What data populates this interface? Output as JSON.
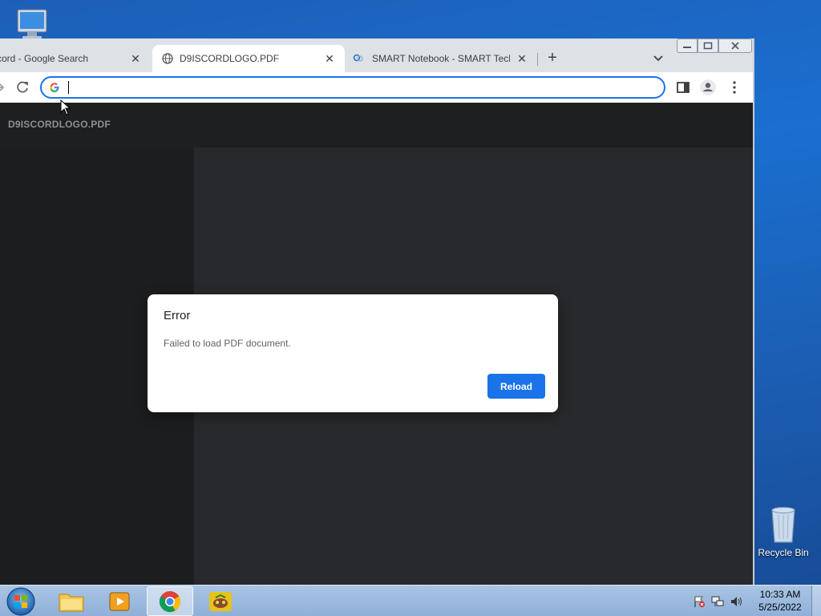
{
  "desktop": {
    "recycle_bin_label": "Recycle Bin"
  },
  "browser": {
    "tabs": [
      {
        "title": "cord - Google Search",
        "close": "✕"
      },
      {
        "title": "D9ISCORDLOGO.PDF",
        "close": "✕"
      },
      {
        "title": "SMART Notebook - SMART Techn",
        "close": "✕"
      }
    ],
    "new_tab": "+",
    "address_value": "",
    "pdf_title": "D9ISCORDLOGO.PDF"
  },
  "dialog": {
    "title": "Error",
    "message": "Failed to load PDF document.",
    "button": "Reload"
  },
  "taskbar": {
    "time": "10:33 AM",
    "date": "5/25/2022"
  },
  "colors": {
    "accent": "#1a73e8",
    "pdf_bg": "#28292c",
    "desktop": "#1a6fd0"
  }
}
